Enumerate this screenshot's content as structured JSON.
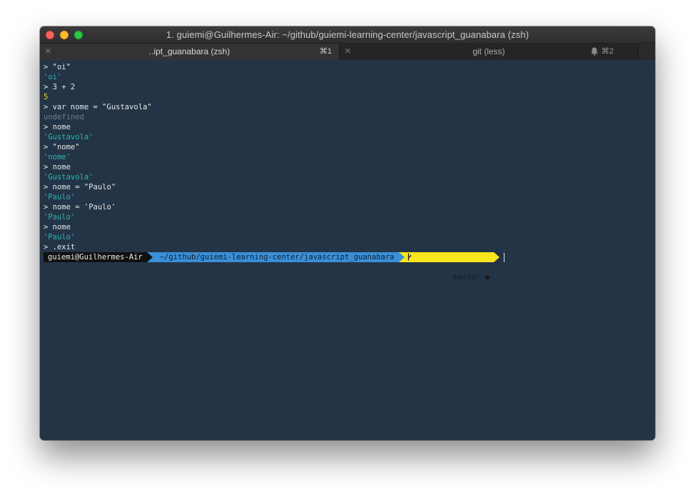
{
  "window": {
    "title": "1. guiemi@Guilhermes-Air: ~/github/guiemi-learning-center/javascript_guanabara (zsh)"
  },
  "tabs": [
    {
      "label": "..ipt_guanabara (zsh)",
      "shortcut": "⌘1",
      "close": "×"
    },
    {
      "label": "git (less)",
      "shortcut": "⌘2",
      "close": "×"
    }
  ],
  "terminal": {
    "lines": [
      {
        "text": "> \"oi\"",
        "kind": "input"
      },
      {
        "text": "'oi'",
        "kind": "string"
      },
      {
        "text": "> 3 + 2",
        "kind": "input"
      },
      {
        "text": "5",
        "kind": "number"
      },
      {
        "text": "> var nome = \"Gustavola\"",
        "kind": "input"
      },
      {
        "text": "undefined",
        "kind": "undefined"
      },
      {
        "text": "> nome",
        "kind": "input"
      },
      {
        "text": "'Gustavola'",
        "kind": "string"
      },
      {
        "text": "> \"nome\"",
        "kind": "input"
      },
      {
        "text": "'nome'",
        "kind": "string"
      },
      {
        "text": "> nome",
        "kind": "input"
      },
      {
        "text": "'Gustavola'",
        "kind": "string"
      },
      {
        "text": "> nome = \"Paulo\"",
        "kind": "input"
      },
      {
        "text": "'Paulo'",
        "kind": "string"
      },
      {
        "text": "> nome = 'Paulo'",
        "kind": "input"
      },
      {
        "text": "'Paulo'",
        "kind": "string"
      },
      {
        "text": "> nome",
        "kind": "input"
      },
      {
        "text": "'Paulo'",
        "kind": "string"
      },
      {
        "text": "> .exit",
        "kind": "input"
      }
    ],
    "prompt": {
      "user": "guiemi@Guilhermes-Air",
      "path": "~/github/guiemi-learning-center/javascript_guanabara",
      "git": " master ●"
    }
  },
  "colors": {
    "background": "#243447",
    "string": "#2ab7a9",
    "number": "#e3d43c",
    "undefined": "#6c7a89",
    "path_segment": "#3a8fd6",
    "git_segment": "#f8e71c"
  }
}
